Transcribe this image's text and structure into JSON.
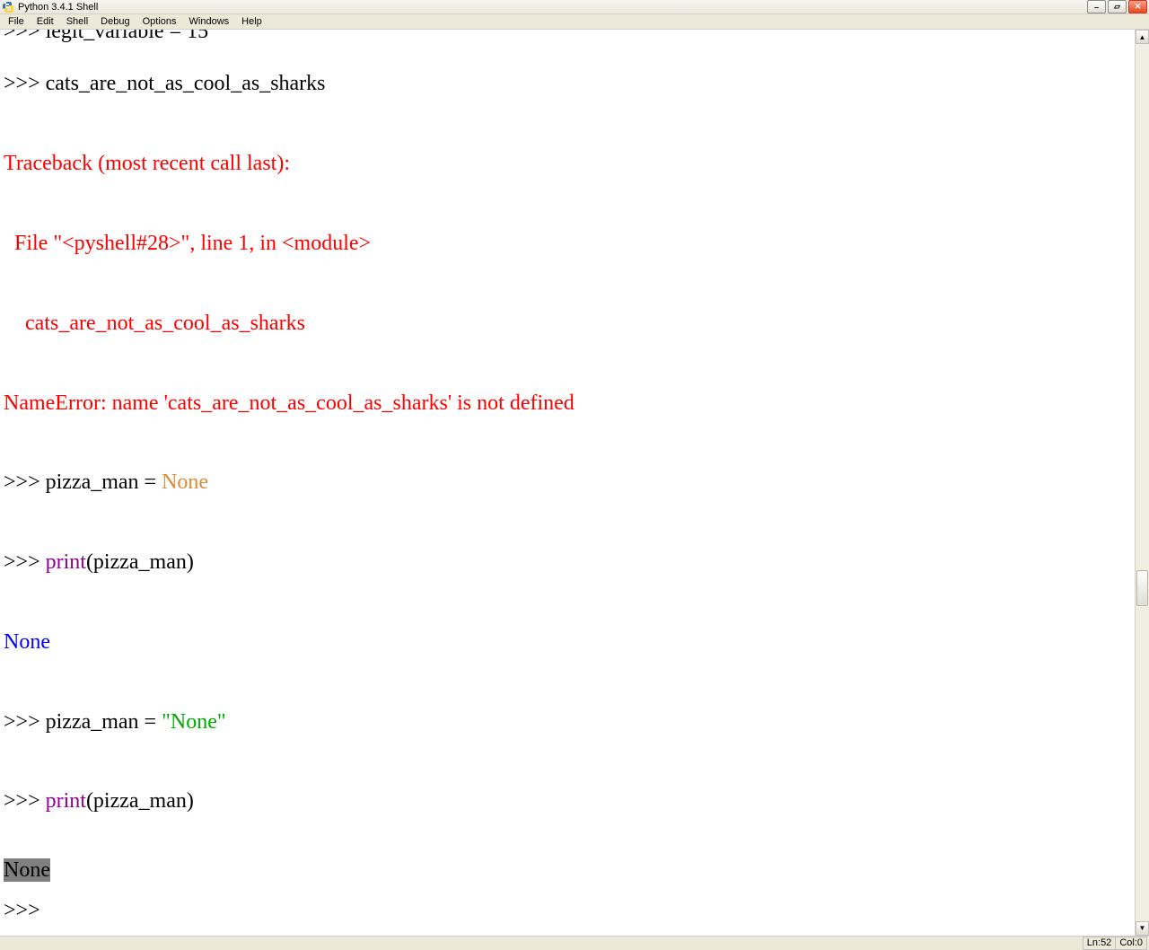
{
  "window": {
    "title": "Python 3.4.1 Shell"
  },
  "menu": {
    "items": [
      "File",
      "Edit",
      "Shell",
      "Debug",
      "Options",
      "Windows",
      "Help"
    ]
  },
  "shell": {
    "prompt": ">>> ",
    "line_cutoff": "legit_variable = 15",
    "line1": "cats_are_not_as_cool_as_sharks",
    "tb1": "Traceback (most recent call last):",
    "tb2": "  File \"<pyshell#28>\", line 1, in <module>",
    "tb3": "    cats_are_not_as_cool_as_sharks",
    "tb4": "NameError: name 'cats_are_not_as_cool_as_sharks' is not defined",
    "line2_a": "pizza_man = ",
    "line2_b": "None",
    "line3_a": "print",
    "line3_b": "(pizza_man)",
    "out1": "None",
    "line4_a": "pizza_man = ",
    "line4_b": "\"None\"",
    "line5_a": "print",
    "line5_b": "(pizza_man)",
    "out2": "None"
  },
  "status": {
    "line_label": "Ln: ",
    "line_value": "52",
    "col_label": "Col: ",
    "col_value": "0"
  }
}
